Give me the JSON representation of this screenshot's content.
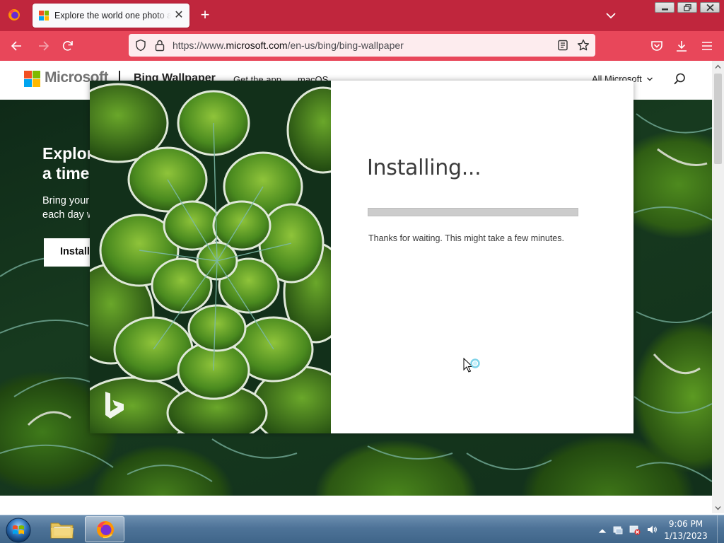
{
  "browser": {
    "tab_title": "Explore the world one photo at a time",
    "url_prefix": "https://www.",
    "url_domain": "microsoft.com",
    "url_path": "/en-us/bing/bing-wallpaper",
    "theme_tabbar_color": "#c0263d",
    "theme_navbar_color": "#e8475a"
  },
  "site_header": {
    "brand": "Microsoft",
    "product": "Bing Wallpaper",
    "links": [
      "Get the app",
      "macOS"
    ],
    "all_microsoft": "All Microsoft"
  },
  "hero": {
    "title_line1": "Explor",
    "title_line2": "a time",
    "sub_line1": "Bring your",
    "sub_line2": "each day w",
    "button": "Install"
  },
  "installer": {
    "title": "Installing...",
    "message": "Thanks for waiting. This might take a few minutes.",
    "progress": 0
  },
  "taskbar": {
    "items": [
      "windows-explorer",
      "firefox"
    ],
    "time": "9:06 PM",
    "date": "1/13/2023"
  }
}
